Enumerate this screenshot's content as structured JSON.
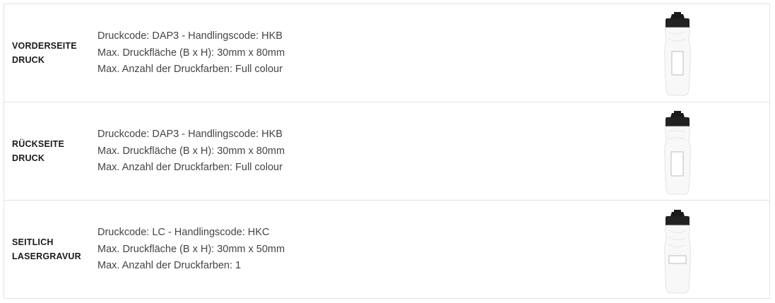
{
  "rows": [
    {
      "label_line1": "VORDERSEITE",
      "label_line2": "DRUCK",
      "druckcode": "Druckcode: DAP3 - Handlingscode: HKB",
      "flaeche": "Max. Druckfläche (B x H): 30mm x 80mm",
      "farben": "Max. Anzahl der Druckfarben: Full colour",
      "image_icon": "bottle-front-icon"
    },
    {
      "label_line1": "RÜCKSEITE",
      "label_line2": "DRUCK",
      "druckcode": "Druckcode: DAP3 - Handlingscode: HKB",
      "flaeche": "Max. Druckfläche (B x H): 30mm x 80mm",
      "farben": "Max. Anzahl der Druckfarben: Full colour",
      "image_icon": "bottle-back-icon"
    },
    {
      "label_line1": "SEITLICH",
      "label_line2": "LASERGRAVUR",
      "druckcode": "Druckcode: LC - Handlingscode: HKC",
      "flaeche": "Max. Druckfläche (B x H): 30mm x 50mm",
      "farben": "Max. Anzahl der Druckfarben: 1",
      "image_icon": "bottle-side-icon"
    }
  ],
  "colors": {
    "border": "#e3e3e3",
    "label_text": "#1a1a1a",
    "detail_text": "#444444",
    "cap": "#1b1b1b"
  }
}
